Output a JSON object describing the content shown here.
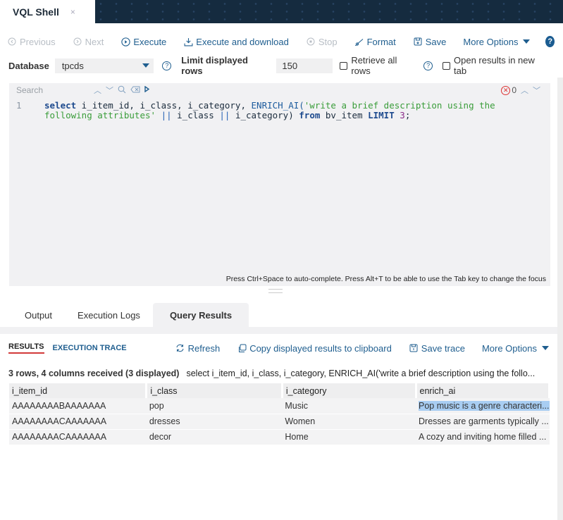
{
  "window": {
    "tab_title": "VQL Shell",
    "close_glyph": "×"
  },
  "toolbar": {
    "buttons": [
      {
        "label": "Previous",
        "icon": "circle-arrow-left-icon",
        "enabled": false
      },
      {
        "label": "Next",
        "icon": "circle-arrow-right-icon",
        "enabled": false
      },
      {
        "label": "Execute",
        "icon": "play-circle-icon",
        "enabled": true
      },
      {
        "label": "Execute and download",
        "icon": "download-icon",
        "enabled": true
      },
      {
        "label": "Stop",
        "icon": "stop-circle-icon",
        "enabled": false
      },
      {
        "label": "Format",
        "icon": "brush-icon",
        "enabled": true
      },
      {
        "label": "Save",
        "icon": "save-icon",
        "enabled": true
      }
    ],
    "more_options": "More Options",
    "help": "?"
  },
  "database_row": {
    "database_label": "Database",
    "database_value": "tpcds",
    "limit_label": "Limit displayed rows",
    "limit_value": "150",
    "retrieve_all_label": "Retrieve all rows",
    "retrieve_all_checked": false,
    "open_new_tab_label": "Open results in new tab",
    "open_new_tab_checked": false
  },
  "editor": {
    "search_placeholder": "Search",
    "error_count": "0",
    "line_number": "1",
    "hint": "Press Ctrl+Space to auto-complete. Press Alt+T to be able to use the Tab key to change the focus",
    "code": {
      "kw_select": "select",
      "cols": " i_item_id, i_class, i_category, ",
      "fn": "ENRICH_AI(",
      "str1": "'write a brief description using the",
      "str2": "following attributes'",
      "op1": " || ",
      "mid": "i_class",
      "op2": " || ",
      "tail1": "i_category) ",
      "kw_from": "from",
      "table": " bv_item ",
      "kw_limit": "LIMIT",
      "num": " 3",
      "end": ";"
    }
  },
  "bottom_tabs": [
    "Output",
    "Execution Logs",
    "Query Results"
  ],
  "results": {
    "subtabs": [
      "RESULTS",
      "EXECUTION TRACE"
    ],
    "actions": {
      "refresh": "Refresh",
      "copy": "Copy displayed results to clipboard",
      "save_trace": "Save trace",
      "more_options": "More Options"
    },
    "summary_count": "3 rows, 4 columns received (3 displayed)",
    "summary_query": "select i_item_id, i_class, i_category, ENRICH_AI('write a brief description using the follo...",
    "columns": [
      "i_item_id",
      "i_class",
      "i_category",
      "enrich_ai"
    ],
    "rows": [
      [
        "AAAAAAAABAAAAAAA",
        "pop",
        "Music",
        "Pop music is a genre characteri..."
      ],
      [
        "AAAAAAAACAAAAAAA",
        "dresses",
        "Women",
        "Dresses are garments typically ..."
      ],
      [
        "AAAAAAAACAAAAAAA",
        "decor",
        "Home",
        "A cozy and inviting home filled ..."
      ]
    ]
  },
  "colors": {
    "accent": "#1f5e8f",
    "header_bg": "#152b3f",
    "active_subtab_underline": "#d23a3a",
    "selection": "#a8cdf2"
  }
}
